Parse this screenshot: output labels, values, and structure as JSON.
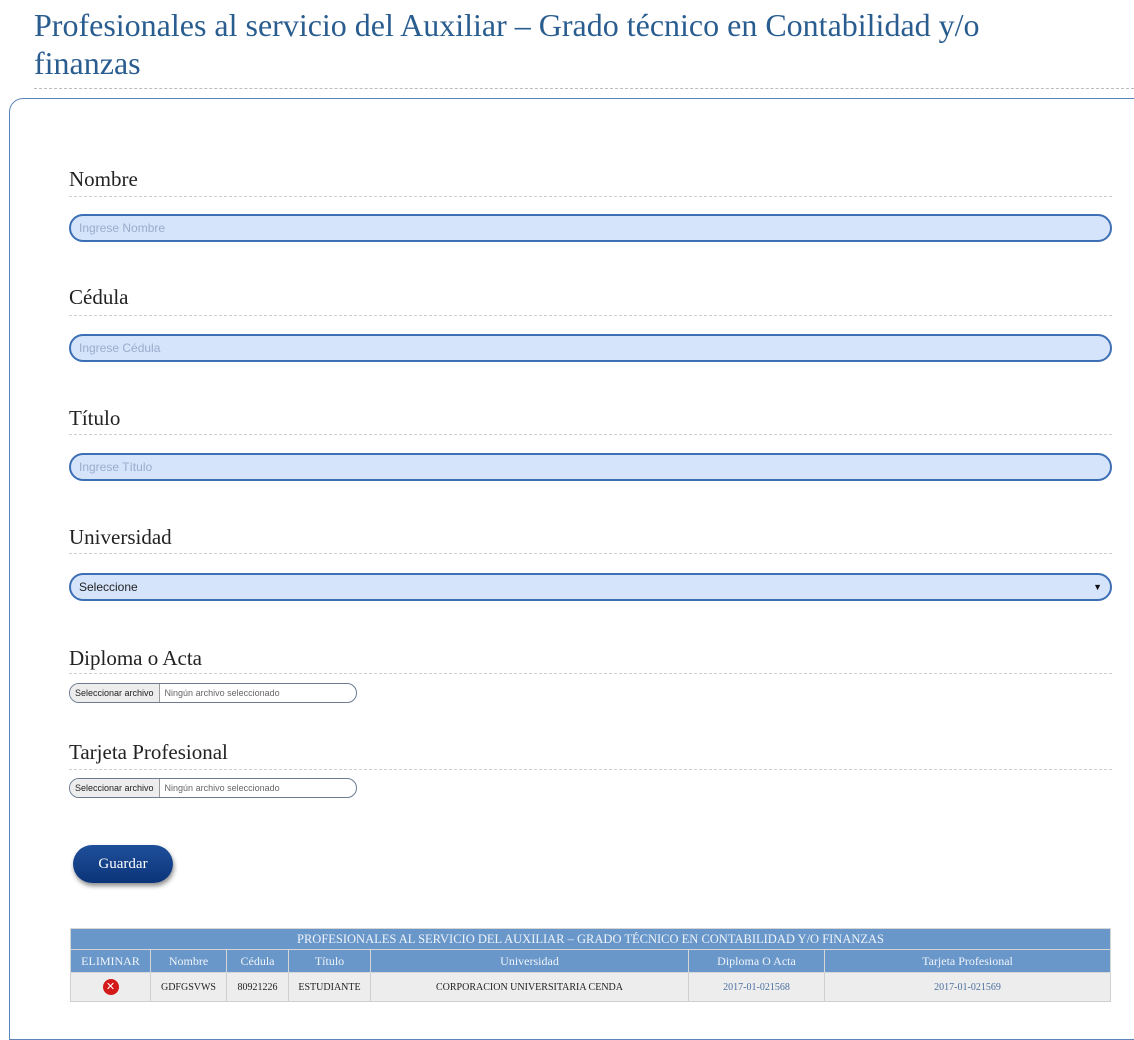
{
  "page": {
    "title": "Profesionales al servicio del Auxiliar – Grado técnico en Contabilidad y/o finanzas"
  },
  "form": {
    "nombre": {
      "label": "Nombre",
      "placeholder": "Ingrese Nombre",
      "value": ""
    },
    "cedula": {
      "label": "Cédula",
      "placeholder": "Ingrese Cédula",
      "value": ""
    },
    "titulo": {
      "label": "Título",
      "placeholder": "Ingrese Título",
      "value": ""
    },
    "universidad": {
      "label": "Universidad",
      "selected": "Seleccione"
    },
    "diploma": {
      "label": "Diploma o Acta",
      "button": "Seleccionar archivo",
      "status": "Ningún archivo seleccionado"
    },
    "tarjeta": {
      "label": "Tarjeta Profesional",
      "button": "Seleccionar archivo",
      "status": "Ningún archivo seleccionado"
    },
    "save_label": "Guardar"
  },
  "table": {
    "title": "PROFESIONALES AL SERVICIO DEL AUXILIAR – GRADO TÉCNICO EN CONTABILIDAD Y/O FINANZAS",
    "columns": [
      "ELIMINAR",
      "Nombre",
      "Cédula",
      "Título",
      "Universidad",
      "Diploma O Acta",
      "Tarjeta Profesional"
    ],
    "rows": [
      {
        "eliminar_icon": "delete-icon",
        "nombre": "GDFGSVWS",
        "cedula": "80921226",
        "titulo": "ESTUDIANTE",
        "universidad": "CORPORACION UNIVERSITARIA CENDA",
        "diploma": "2017-01-021568",
        "tarjeta": "2017-01-021569"
      }
    ]
  },
  "colors": {
    "accent": "#2a5d8f",
    "input_bg": "#d5e4fb",
    "input_border": "#3d6fb5",
    "table_header": "#6a97c9",
    "button": "#0b3479",
    "delete": "#d41919"
  }
}
